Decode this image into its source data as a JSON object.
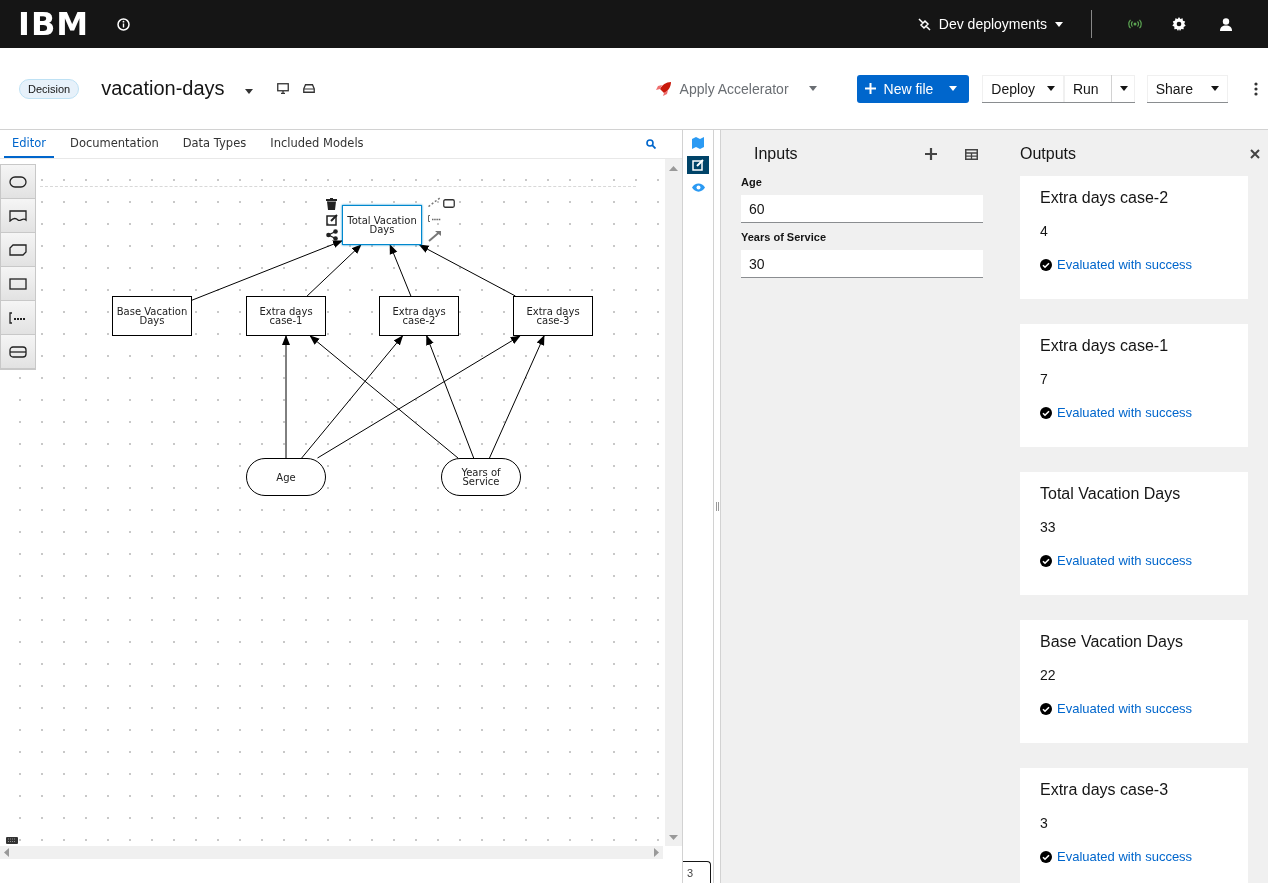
{
  "topbar": {
    "logo": "IBM",
    "deployments": "Dev deployments"
  },
  "header": {
    "badge": "Decision",
    "title": "vacation-days",
    "accelerator": {
      "label": "Apply Accelerator",
      "disabled": true
    },
    "new_file": "New file",
    "deploy": "Deploy",
    "run": "Run",
    "share": "Share"
  },
  "tabs": [
    {
      "label": "Editor",
      "selected": true
    },
    {
      "label": "Documentation",
      "selected": false
    },
    {
      "label": "Data Types",
      "selected": false
    },
    {
      "label": "Included Models",
      "selected": false
    }
  ],
  "side_tools": [
    {
      "kind": "map",
      "selected": false
    },
    {
      "kind": "edit",
      "selected": true
    },
    {
      "kind": "preview",
      "selected": false
    }
  ],
  "palette": [
    {
      "kind": "input"
    },
    {
      "kind": "knowledge"
    },
    {
      "kind": "bkm"
    },
    {
      "kind": "decision"
    },
    {
      "kind": "annotation"
    },
    {
      "kind": "service"
    }
  ],
  "diagram": {
    "nodes": [
      {
        "kind": "decision",
        "label": "Total Vacation Days",
        "selected": true
      },
      {
        "kind": "decision",
        "label": "Base Vacation Days",
        "selected": false
      },
      {
        "kind": "decision",
        "label": "Extra days case-1",
        "selected": false
      },
      {
        "kind": "decision",
        "label": "Extra days case-2",
        "selected": false
      },
      {
        "kind": "decision",
        "label": "Extra days case-3",
        "selected": false
      },
      {
        "kind": "input",
        "label": "Age",
        "selected": false
      },
      {
        "kind": "input",
        "label": "Years of Service",
        "selected": false
      }
    ]
  },
  "inputs": {
    "title": "Inputs",
    "fields": [
      {
        "label": "Age",
        "value": "60"
      },
      {
        "label": "Years of Service",
        "value": "30"
      }
    ]
  },
  "outputs": {
    "title": "Outputs",
    "cards": [
      {
        "title": "Extra days case-2",
        "value": "4",
        "message": "Evaluated with success"
      },
      {
        "title": "Extra days case-1",
        "value": "7",
        "message": "Evaluated with success"
      },
      {
        "title": "Total Vacation Days",
        "value": "33",
        "message": "Evaluated with success"
      },
      {
        "title": "Base Vacation Days",
        "value": "22",
        "message": "Evaluated with success"
      },
      {
        "title": "Extra days case-3",
        "value": "3",
        "message": "Evaluated with success"
      }
    ]
  },
  "footer": {
    "count": "3"
  }
}
